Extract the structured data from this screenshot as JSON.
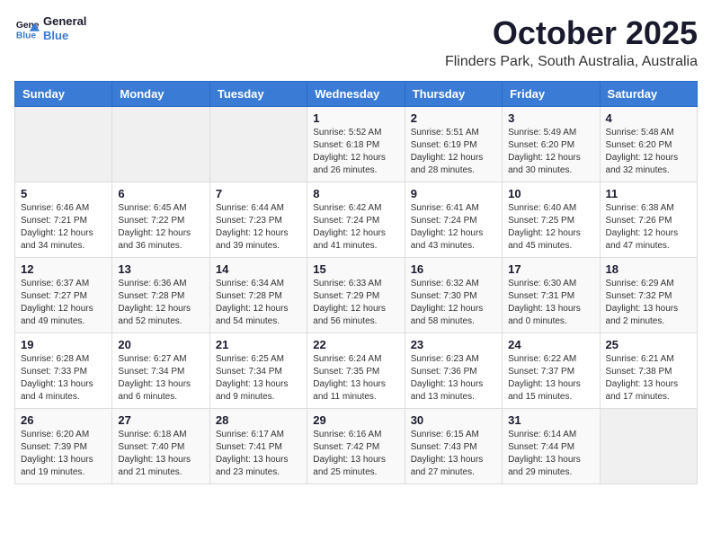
{
  "logo": {
    "line1": "General",
    "line2": "Blue"
  },
  "title": "October 2025",
  "subtitle": "Flinders Park, South Australia, Australia",
  "days_header": [
    "Sunday",
    "Monday",
    "Tuesday",
    "Wednesday",
    "Thursday",
    "Friday",
    "Saturday"
  ],
  "weeks": [
    [
      {
        "day": "",
        "info": ""
      },
      {
        "day": "",
        "info": ""
      },
      {
        "day": "",
        "info": ""
      },
      {
        "day": "1",
        "info": "Sunrise: 5:52 AM\nSunset: 6:18 PM\nDaylight: 12 hours\nand 26 minutes."
      },
      {
        "day": "2",
        "info": "Sunrise: 5:51 AM\nSunset: 6:19 PM\nDaylight: 12 hours\nand 28 minutes."
      },
      {
        "day": "3",
        "info": "Sunrise: 5:49 AM\nSunset: 6:20 PM\nDaylight: 12 hours\nand 30 minutes."
      },
      {
        "day": "4",
        "info": "Sunrise: 5:48 AM\nSunset: 6:20 PM\nDaylight: 12 hours\nand 32 minutes."
      }
    ],
    [
      {
        "day": "5",
        "info": "Sunrise: 6:46 AM\nSunset: 7:21 PM\nDaylight: 12 hours\nand 34 minutes."
      },
      {
        "day": "6",
        "info": "Sunrise: 6:45 AM\nSunset: 7:22 PM\nDaylight: 12 hours\nand 36 minutes."
      },
      {
        "day": "7",
        "info": "Sunrise: 6:44 AM\nSunset: 7:23 PM\nDaylight: 12 hours\nand 39 minutes."
      },
      {
        "day": "8",
        "info": "Sunrise: 6:42 AM\nSunset: 7:24 PM\nDaylight: 12 hours\nand 41 minutes."
      },
      {
        "day": "9",
        "info": "Sunrise: 6:41 AM\nSunset: 7:24 PM\nDaylight: 12 hours\nand 43 minutes."
      },
      {
        "day": "10",
        "info": "Sunrise: 6:40 AM\nSunset: 7:25 PM\nDaylight: 12 hours\nand 45 minutes."
      },
      {
        "day": "11",
        "info": "Sunrise: 6:38 AM\nSunset: 7:26 PM\nDaylight: 12 hours\nand 47 minutes."
      }
    ],
    [
      {
        "day": "12",
        "info": "Sunrise: 6:37 AM\nSunset: 7:27 PM\nDaylight: 12 hours\nand 49 minutes."
      },
      {
        "day": "13",
        "info": "Sunrise: 6:36 AM\nSunset: 7:28 PM\nDaylight: 12 hours\nand 52 minutes."
      },
      {
        "day": "14",
        "info": "Sunrise: 6:34 AM\nSunset: 7:28 PM\nDaylight: 12 hours\nand 54 minutes."
      },
      {
        "day": "15",
        "info": "Sunrise: 6:33 AM\nSunset: 7:29 PM\nDaylight: 12 hours\nand 56 minutes."
      },
      {
        "day": "16",
        "info": "Sunrise: 6:32 AM\nSunset: 7:30 PM\nDaylight: 12 hours\nand 58 minutes."
      },
      {
        "day": "17",
        "info": "Sunrise: 6:30 AM\nSunset: 7:31 PM\nDaylight: 13 hours\nand 0 minutes."
      },
      {
        "day": "18",
        "info": "Sunrise: 6:29 AM\nSunset: 7:32 PM\nDaylight: 13 hours\nand 2 minutes."
      }
    ],
    [
      {
        "day": "19",
        "info": "Sunrise: 6:28 AM\nSunset: 7:33 PM\nDaylight: 13 hours\nand 4 minutes."
      },
      {
        "day": "20",
        "info": "Sunrise: 6:27 AM\nSunset: 7:34 PM\nDaylight: 13 hours\nand 6 minutes."
      },
      {
        "day": "21",
        "info": "Sunrise: 6:25 AM\nSunset: 7:34 PM\nDaylight: 13 hours\nand 9 minutes."
      },
      {
        "day": "22",
        "info": "Sunrise: 6:24 AM\nSunset: 7:35 PM\nDaylight: 13 hours\nand 11 minutes."
      },
      {
        "day": "23",
        "info": "Sunrise: 6:23 AM\nSunset: 7:36 PM\nDaylight: 13 hours\nand 13 minutes."
      },
      {
        "day": "24",
        "info": "Sunrise: 6:22 AM\nSunset: 7:37 PM\nDaylight: 13 hours\nand 15 minutes."
      },
      {
        "day": "25",
        "info": "Sunrise: 6:21 AM\nSunset: 7:38 PM\nDaylight: 13 hours\nand 17 minutes."
      }
    ],
    [
      {
        "day": "26",
        "info": "Sunrise: 6:20 AM\nSunset: 7:39 PM\nDaylight: 13 hours\nand 19 minutes."
      },
      {
        "day": "27",
        "info": "Sunrise: 6:18 AM\nSunset: 7:40 PM\nDaylight: 13 hours\nand 21 minutes."
      },
      {
        "day": "28",
        "info": "Sunrise: 6:17 AM\nSunset: 7:41 PM\nDaylight: 13 hours\nand 23 minutes."
      },
      {
        "day": "29",
        "info": "Sunrise: 6:16 AM\nSunset: 7:42 PM\nDaylight: 13 hours\nand 25 minutes."
      },
      {
        "day": "30",
        "info": "Sunrise: 6:15 AM\nSunset: 7:43 PM\nDaylight: 13 hours\nand 27 minutes."
      },
      {
        "day": "31",
        "info": "Sunrise: 6:14 AM\nSunset: 7:44 PM\nDaylight: 13 hours\nand 29 minutes."
      },
      {
        "day": "",
        "info": ""
      }
    ]
  ]
}
